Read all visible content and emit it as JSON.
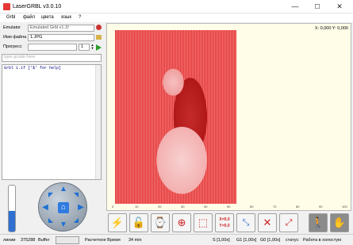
{
  "window": {
    "title": "LaserGRBL v3.0.10",
    "minimize": "—",
    "maximize": "☐",
    "close": "✕"
  },
  "menu": [
    "Grbl",
    "файл",
    "цвета",
    "язык",
    "?"
  ],
  "left": {
    "emulator_label": "Emulator",
    "emulator_value": "Emulated Grbl v1.1f",
    "filename_label": "Имя файла",
    "filename_value": "1.JPG",
    "progress_label": "Прогресс",
    "copies": "1",
    "gcode_placeholder": "type gcode here",
    "console_line": "Grbl 1.1f ['$' for help]",
    "speed_level": 0.45
  },
  "canvas": {
    "coords": "X: 0,000 Y: 0,000",
    "ruler": [
      "0",
      "10",
      "20",
      "30",
      "40",
      "50",
      "60",
      "70",
      "80",
      "90",
      "100"
    ]
  },
  "toolbar": {
    "xy": "X=0,0\nY=0,0",
    "x_line": "X=0,0",
    "y_line": "Y=0,0"
  },
  "status": {
    "lines_label": "линии",
    "lines_value": "375288",
    "buffer_label": "Buffer",
    "time_label": "Расчетное Время",
    "time_value": "34 min",
    "s": "S [1,00x]",
    "g1": "G1 [1,00x]",
    "g0": "G0 [1,00x]",
    "status_label": "статус:",
    "status_value": "Работа в холостую"
  }
}
